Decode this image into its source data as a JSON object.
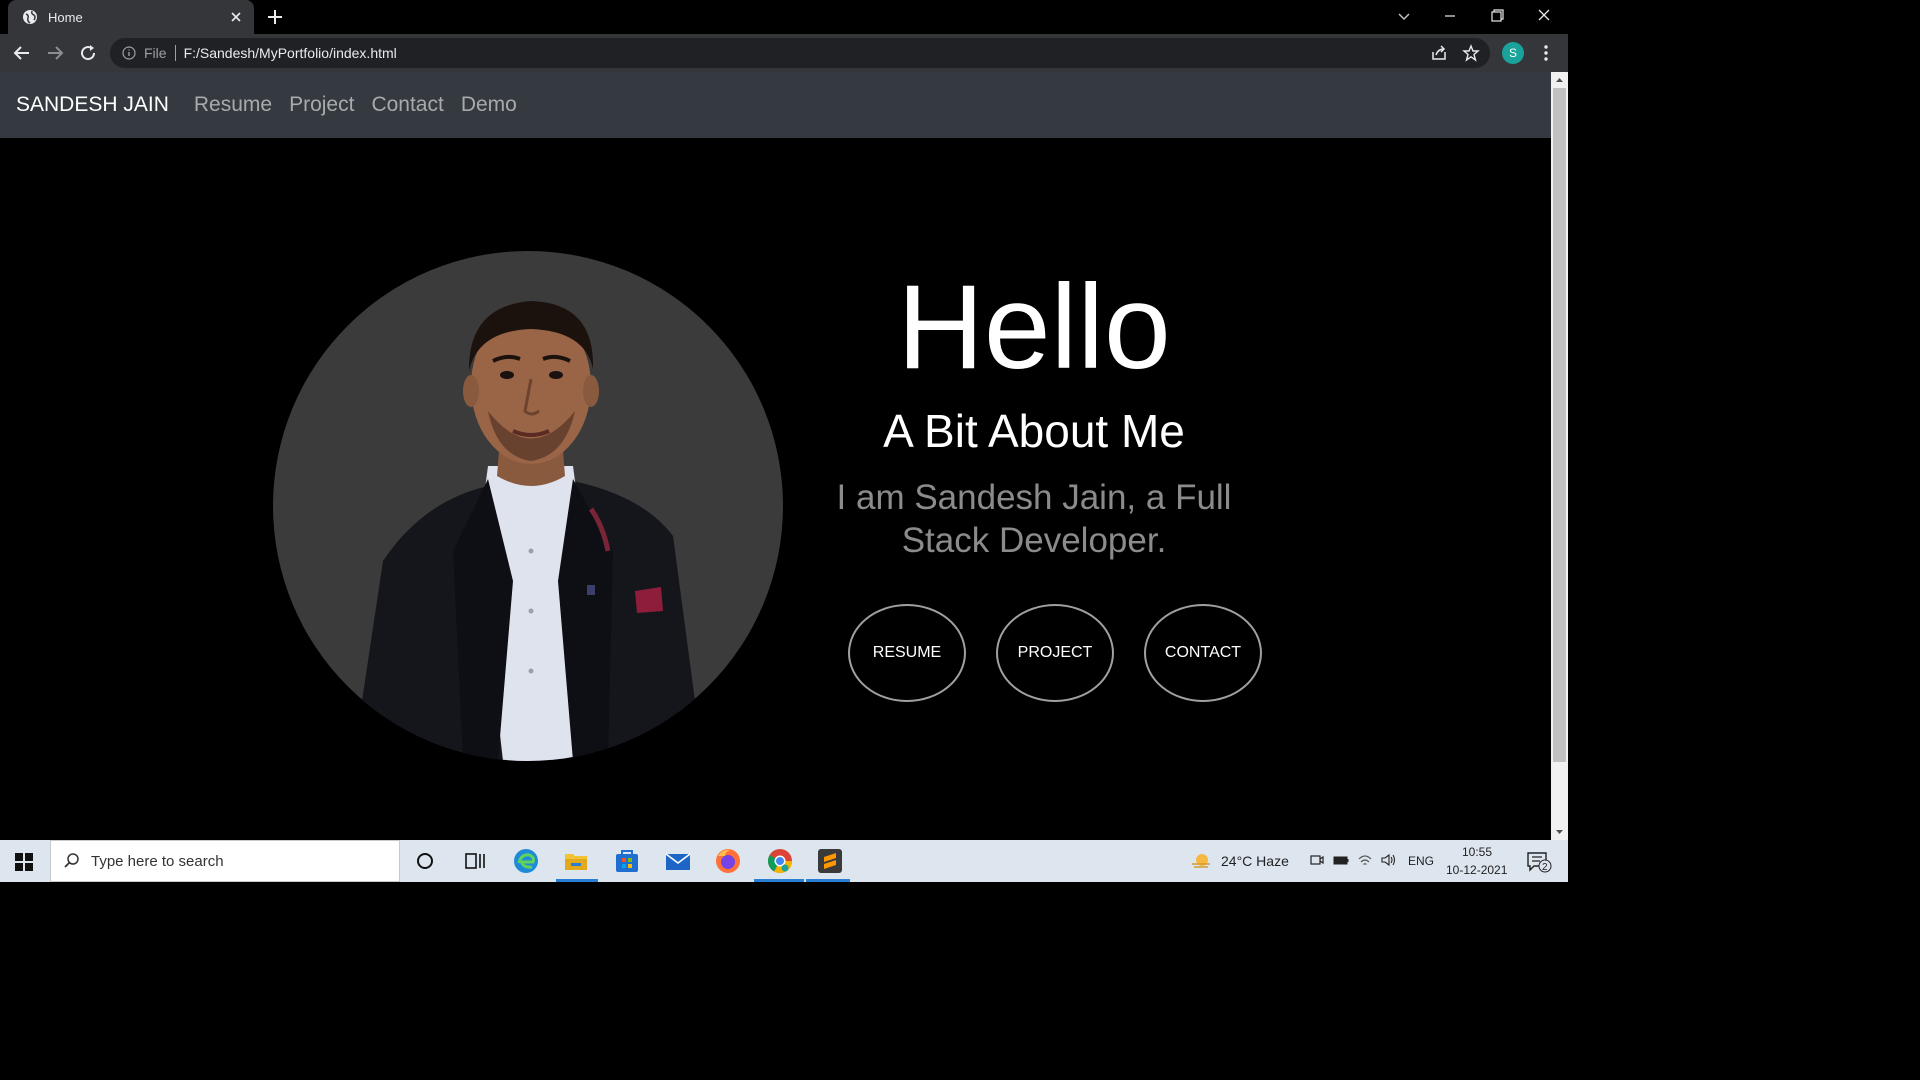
{
  "browser": {
    "tab_title": "Home",
    "address_scheme": "File",
    "address_url": "F:/Sandesh/MyPortfolio/index.html",
    "profile_initial": "S"
  },
  "navbar": {
    "brand": "SANDESH JAIN",
    "links": [
      "Resume",
      "Project",
      "Contact",
      "Demo"
    ]
  },
  "hero": {
    "greeting": "Hello",
    "subtitle": "A Bit About Me",
    "intro": "I am Sandesh Jain, a Full Stack Developer.",
    "buttons": [
      "RESUME",
      "PROJECT",
      "CONTACT"
    ]
  },
  "taskbar": {
    "search_placeholder": "Type here to search",
    "weather": "24°C  Haze",
    "language": "ENG",
    "time": "10:55",
    "date": "10-12-2021",
    "notification_count": "2"
  },
  "colors": {
    "page_bg": "#000000",
    "navbar_bg": "#343a40",
    "nav_link": "#a9aaab",
    "intro_text": "#8b8b8b",
    "photo_bg": "#3b3b3b",
    "profile_badge": "#1aa39a"
  }
}
